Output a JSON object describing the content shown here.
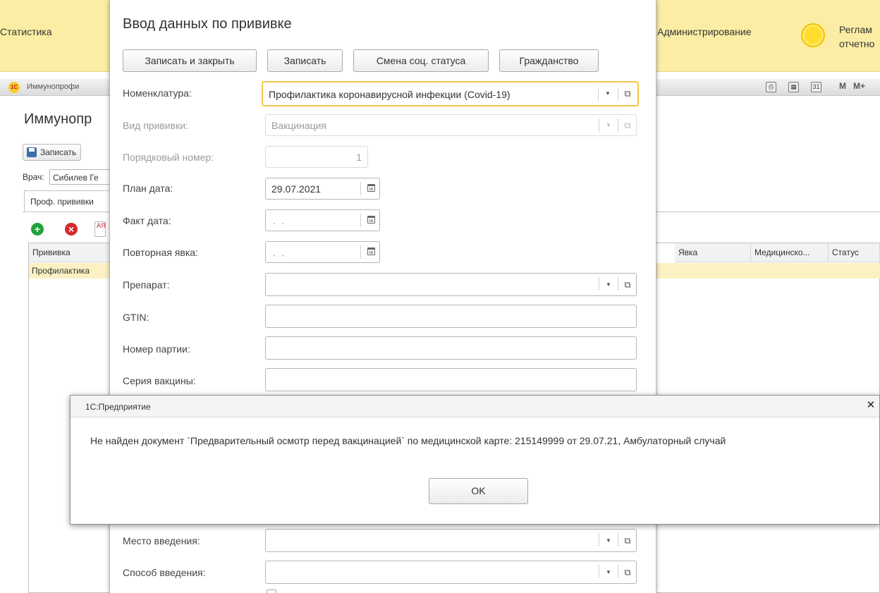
{
  "topbar": {
    "sections": [
      "Статистика",
      "Администрирование",
      "Реглам",
      "отчетно"
    ]
  },
  "strip": {
    "window_tab": "Иммунопрофи",
    "memory_m": "M",
    "memory_mplus": "M+"
  },
  "background": {
    "doc_title": "Иммунопр",
    "save_label": "Записать",
    "doctor_label": "Врач:",
    "doctor_value": "Сибилев Ге",
    "tab_label": "Проф. прививки",
    "sort_icon_text": "АЯ",
    "columns": [
      "Прививка",
      "Явка",
      "Медицинско...",
      "Статус"
    ],
    "row_first_cell": "Профилактика"
  },
  "form": {
    "title": "Ввод данных по прививке",
    "buttons": {
      "save_close": "Записать и закрыть",
      "save": "Записать",
      "social_status": "Смена соц. статуса",
      "citizenship": "Гражданство"
    },
    "fields": {
      "nomenclature": {
        "label": "Номенклатура:",
        "value": "Профилактика коронавирусной инфекции (Covid-19)"
      },
      "vaccination_type": {
        "label": "Вид прививки:",
        "value": "Вакцинация"
      },
      "sequence_number": {
        "label": "Порядковый номер:",
        "value": "1"
      },
      "plan_date": {
        "label": "План дата:",
        "value": "29.07.2021"
      },
      "fact_date": {
        "label": "Факт дата:",
        "value": ". ."
      },
      "repeat_visit": {
        "label": "Повторная явка:",
        "value": ". ."
      },
      "drug": {
        "label": "Препарат:",
        "value": ""
      },
      "gtin": {
        "label": "GTIN:",
        "value": ""
      },
      "batch_number": {
        "label": "Номер партии:",
        "value": ""
      },
      "vaccine_series": {
        "label": "Серия вакцины:",
        "value": ""
      },
      "injection_site": {
        "label": "Место введения:",
        "value": ""
      },
      "injection_method": {
        "label": "Способ введения:",
        "value": ""
      }
    }
  },
  "dialog": {
    "title": "1С:Предприятие",
    "message": "Не найден документ `Предварительный осмотр перед вакцинацией` по медицинской карте: 215149999 от 29.07.21, Амбулаторный случай",
    "ok_label": "OK"
  },
  "colors": {
    "section_bar": "#fbeda4",
    "focus_border": "#f2c84b",
    "selected_row": "#fbf1c3"
  }
}
